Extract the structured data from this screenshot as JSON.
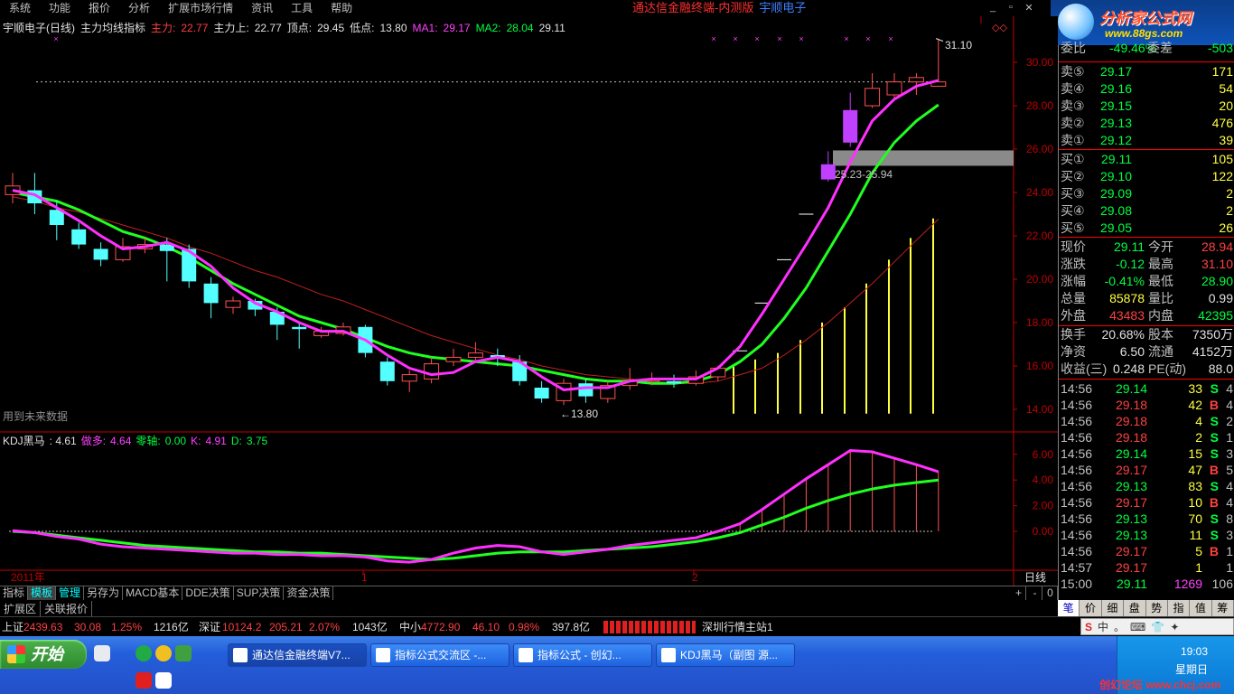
{
  "menu": [
    "系统",
    "功能",
    "报价",
    "分析",
    "扩展市场行情",
    "资讯",
    "工具",
    "帮助"
  ],
  "window_title": "通达信金融终端-内测版",
  "brand": "宇顺电子",
  "logo": {
    "main": "分析家公式网",
    "sub": "www.88gs.com"
  },
  "chart_header": {
    "name": "宇顺电子(日线)",
    "indicator": "主力均线指标",
    "zl_label": "主力:",
    "zl_value": "22.77",
    "zls_label": "主力上:",
    "zls_value": "22.77",
    "top_label": "顶点:",
    "top_value": "29.45",
    "low_label": "低点:",
    "low_value": "13.80",
    "ma1_label": "MA1:",
    "ma1_value": "29.17",
    "ma2_label": "MA2:",
    "ma2_value": "28.04",
    "last_value": "29.11"
  },
  "ind_header": {
    "name": "KDJ黑马",
    "value": ": 4.61",
    "zd_label": "做多:",
    "zd_value": "4.64",
    "zero_label": "零轴:",
    "zero_value": "0.00",
    "k_label": "K:",
    "k_value": "4.91",
    "d_label": "D:",
    "d_value": "3.75"
  },
  "chart_labels": {
    "high": "31.10",
    "low": "←13.80",
    "band": "25.23-25.94",
    "future": "用到未来数据",
    "year": "2011年",
    "m1": "1",
    "m2": "2",
    "period": "日线"
  },
  "price_axis": [
    "30.00",
    "28.00",
    "26.00",
    "24.00",
    "22.00",
    "20.00",
    "18.00",
    "16.00",
    "14.00"
  ],
  "ind_axis": [
    "6.00",
    "4.00",
    "2.00",
    "0.00"
  ],
  "panel": {
    "top_partial": {
      "label": "委比",
      "value": "-49.46%",
      "label2": "委差",
      "value2": "-503"
    },
    "sell": [
      {
        "label": "卖⑤",
        "price": "29.17",
        "vol": "171"
      },
      {
        "label": "卖④",
        "price": "29.16",
        "vol": "54"
      },
      {
        "label": "卖③",
        "price": "29.15",
        "vol": "20"
      },
      {
        "label": "卖②",
        "price": "29.13",
        "vol": "476"
      },
      {
        "label": "卖①",
        "price": "29.12",
        "vol": "39"
      }
    ],
    "buy": [
      {
        "label": "买①",
        "price": "29.11",
        "vol": "105"
      },
      {
        "label": "买②",
        "price": "29.10",
        "vol": "122"
      },
      {
        "label": "买③",
        "price": "29.09",
        "vol": "2"
      },
      {
        "label": "买④",
        "price": "29.08",
        "vol": "2"
      },
      {
        "label": "买⑤",
        "price": "29.05",
        "vol": "26"
      }
    ],
    "stats": [
      {
        "a": "现价",
        "b": "29.11",
        "c": "今开",
        "d": "28.94"
      },
      {
        "a": "涨跌",
        "b": "-0.12",
        "c": "最高",
        "d": "31.10"
      },
      {
        "a": "涨幅",
        "b": "-0.41%",
        "c": "最低",
        "d": "28.90"
      },
      {
        "a": "总量",
        "b": "85878",
        "c": "量比",
        "d": "0.99"
      },
      {
        "a": "外盘",
        "b": "43483",
        "c": "内盘",
        "d": "42395"
      }
    ],
    "stats2": [
      {
        "a": "换手",
        "b": "20.68%",
        "c": "股本",
        "d": "7350万"
      },
      {
        "a": "净资",
        "b": "6.50",
        "c": "流通",
        "d": "4152万"
      },
      {
        "a": "收益(三)",
        "b": "0.248",
        "c": "PE(动)",
        "d": "88.0"
      }
    ],
    "ticks": [
      {
        "t": "14:56",
        "p": "29.14",
        "v": "33",
        "s": "S",
        "n": "4"
      },
      {
        "t": "14:56",
        "p": "29.18",
        "v": "42",
        "s": "B",
        "n": "4"
      },
      {
        "t": "14:56",
        "p": "29.18",
        "v": "4",
        "s": "S",
        "n": "2"
      },
      {
        "t": "14:56",
        "p": "29.18",
        "v": "2",
        "s": "S",
        "n": "1"
      },
      {
        "t": "14:56",
        "p": "29.14",
        "v": "15",
        "s": "S",
        "n": "3"
      },
      {
        "t": "14:56",
        "p": "29.17",
        "v": "47",
        "s": "B",
        "n": "5"
      },
      {
        "t": "14:56",
        "p": "29.13",
        "v": "83",
        "s": "S",
        "n": "4"
      },
      {
        "t": "14:56",
        "p": "29.17",
        "v": "10",
        "s": "B",
        "n": "4"
      },
      {
        "t": "14:56",
        "p": "29.13",
        "v": "70",
        "s": "S",
        "n": "8"
      },
      {
        "t": "14:56",
        "p": "29.13",
        "v": "11",
        "s": "S",
        "n": "3"
      },
      {
        "t": "14:56",
        "p": "29.17",
        "v": "5",
        "s": "B",
        "n": "1"
      },
      {
        "t": "14:57",
        "p": "29.17",
        "v": "1",
        "s": "",
        "n": "1"
      },
      {
        "t": "15:00",
        "p": "29.11",
        "v": "1269",
        "s": "",
        "n": "106"
      }
    ],
    "tabs": [
      "笔",
      "价",
      "细",
      "盘",
      "势",
      "指",
      "值",
      "筹"
    ]
  },
  "chart_tabs": [
    "指标",
    "模板",
    "管理",
    "另存为",
    "MACD基本",
    "DDE决策",
    "SUP决策",
    "资金决策"
  ],
  "chart_ctrls": [
    "+",
    "-",
    "0"
  ],
  "tabs2": [
    "扩展区",
    "关联报价"
  ],
  "status": {
    "sh_label": "上证",
    "sh_val": "2439.63",
    "sh_chg": "30.08",
    "sh_pct": "1.25%",
    "sh_amt": "1216亿",
    "sz_label": "深证",
    "sz_val": "10124.2",
    "sz_chg": "205.21",
    "sz_pct": "2.07%",
    "sz_amt": "1043亿",
    "zx_label": "中小",
    "zx_val": "4772.90",
    "zx_chg": "46.10",
    "zx_pct": "0.98%",
    "zx_amt": "397.8亿",
    "station": "深圳行情主站1"
  },
  "ime": [
    "中",
    "。"
  ],
  "taskbar": {
    "start": "开始",
    "tasks": [
      "通达信金融终端V7...",
      "指标公式交流区 -...",
      "指标公式 - 创幻...",
      "KDJ黑马（副图 源..."
    ],
    "time": "19:03",
    "day": "星期日",
    "watermark": "创幻论坛 www.chcj.com"
  },
  "chart_data": {
    "type": "candlestick",
    "price_range": [
      13.0,
      31.5
    ],
    "candles": [
      {
        "o": 23.9,
        "c": 24.3,
        "h": 24.9,
        "l": 23.5
      },
      {
        "o": 24.1,
        "c": 23.5,
        "h": 24.9,
        "l": 23.0
      },
      {
        "o": 23.2,
        "c": 22.5,
        "h": 23.6,
        "l": 21.8
      },
      {
        "o": 22.3,
        "c": 21.6,
        "h": 22.6,
        "l": 21.4
      },
      {
        "o": 21.4,
        "c": 20.9,
        "h": 21.7,
        "l": 20.6
      },
      {
        "o": 20.9,
        "c": 21.5,
        "h": 21.9,
        "l": 20.8
      },
      {
        "o": 21.4,
        "c": 21.6,
        "h": 21.9,
        "l": 21.2
      },
      {
        "o": 21.6,
        "c": 21.3,
        "h": 21.9,
        "l": 19.9
      },
      {
        "o": 21.4,
        "c": 19.9,
        "h": 21.6,
        "l": 19.6
      },
      {
        "o": 19.8,
        "c": 18.9,
        "h": 20.1,
        "l": 18.2
      },
      {
        "o": 18.7,
        "c": 19.0,
        "h": 19.2,
        "l": 18.4
      },
      {
        "o": 19.0,
        "c": 18.6,
        "h": 19.1,
        "l": 18.3
      },
      {
        "o": 18.5,
        "c": 17.9,
        "h": 18.7,
        "l": 17.2
      },
      {
        "o": 17.8,
        "c": 17.7,
        "h": 18.0,
        "l": 16.8
      },
      {
        "o": 17.4,
        "c": 17.6,
        "h": 17.8,
        "l": 17.3
      },
      {
        "o": 17.5,
        "c": 17.8,
        "h": 18.0,
        "l": 17.4
      },
      {
        "o": 17.8,
        "c": 16.6,
        "h": 17.9,
        "l": 16.4
      },
      {
        "o": 16.2,
        "c": 15.3,
        "h": 16.4,
        "l": 15.1
      },
      {
        "o": 15.3,
        "c": 15.6,
        "h": 15.8,
        "l": 14.8
      },
      {
        "o": 15.4,
        "c": 16.1,
        "h": 16.4,
        "l": 15.2
      },
      {
        "o": 16.2,
        "c": 16.4,
        "h": 16.8,
        "l": 16.0
      },
      {
        "o": 16.4,
        "c": 16.6,
        "h": 17.1,
        "l": 16.2
      },
      {
        "o": 16.5,
        "c": 16.4,
        "h": 16.8,
        "l": 16.0
      },
      {
        "o": 16.2,
        "c": 15.3,
        "h": 16.5,
        "l": 15.1
      },
      {
        "o": 15.0,
        "c": 14.5,
        "h": 15.3,
        "l": 14.3
      },
      {
        "o": 14.4,
        "c": 15.2,
        "h": 15.4,
        "l": 14.2
      },
      {
        "o": 15.2,
        "c": 14.6,
        "h": 15.4,
        "l": 14.3
      },
      {
        "o": 14.5,
        "c": 15.1,
        "h": 15.3,
        "l": 14.3
      },
      {
        "o": 15.1,
        "c": 15.3,
        "h": 15.9,
        "l": 14.9
      },
      {
        "o": 15.3,
        "c": 15.4,
        "h": 15.7,
        "l": 15.1
      },
      {
        "o": 15.3,
        "c": 15.2,
        "h": 15.6,
        "l": 15.0
      },
      {
        "o": 15.2,
        "c": 15.5,
        "h": 15.8,
        "l": 15.1
      },
      {
        "o": 15.5,
        "c": 15.9,
        "h": 16.0,
        "l": 15.3
      },
      {
        "o": 16.7,
        "c": 16.7,
        "h": 16.7,
        "l": 16.7
      },
      {
        "o": 18.9,
        "c": 18.9,
        "h": 18.9,
        "l": 18.9
      },
      {
        "o": 20.9,
        "c": 20.9,
        "h": 20.9,
        "l": 20.9
      },
      {
        "o": 23.0,
        "c": 23.0,
        "h": 23.0,
        "l": 23.0
      },
      {
        "o": 24.6,
        "c": 25.3,
        "h": 25.9,
        "l": 24.5
      },
      {
        "o": 26.3,
        "c": 27.8,
        "h": 28.6,
        "l": 26.1
      },
      {
        "o": 28.0,
        "c": 28.8,
        "h": 29.5,
        "l": 27.9
      },
      {
        "o": 28.5,
        "c": 29.1,
        "h": 29.5,
        "l": 28.3
      },
      {
        "o": 29.1,
        "c": 29.3,
        "h": 29.5,
        "l": 28.5
      },
      {
        "o": 28.9,
        "c": 29.1,
        "h": 31.1,
        "l": 28.9
      }
    ],
    "ma1": [
      24.1,
      23.9,
      23.3,
      22.7,
      22.0,
      21.4,
      21.5,
      21.7,
      21.3,
      20.6,
      19.6,
      18.9,
      18.5,
      18.0,
      17.6,
      17.6,
      17.2,
      16.5,
      15.9,
      15.6,
      15.7,
      16.2,
      16.4,
      16.2,
      15.5,
      14.9,
      15.0,
      15.0,
      15.3,
      15.4,
      15.4,
      15.4,
      15.9,
      16.9,
      18.4,
      20.0,
      21.6,
      23.3,
      25.4,
      27.3,
      28.3,
      28.9,
      29.17
    ],
    "ma2": [
      24.0,
      23.8,
      23.6,
      23.2,
      22.7,
      22.2,
      21.9,
      21.5,
      21.0,
      20.4,
      19.8,
      19.3,
      18.8,
      18.3,
      18.0,
      17.7,
      17.3,
      16.9,
      16.6,
      16.4,
      16.3,
      16.2,
      16.1,
      16.0,
      15.8,
      15.6,
      15.4,
      15.3,
      15.3,
      15.2,
      15.2,
      15.3,
      15.6,
      16.2,
      17.0,
      18.2,
      19.6,
      21.3,
      23.0,
      24.9,
      26.3,
      27.3,
      28.04
    ],
    "zl": [
      23.8,
      23.6,
      23.3,
      23.1,
      22.8,
      22.5,
      22.2,
      21.9,
      21.5,
      21.2,
      20.8,
      20.4,
      20.1,
      19.7,
      19.3,
      19.0,
      18.6,
      18.2,
      17.8,
      17.4,
      17.1,
      16.8,
      16.5,
      16.3,
      16.0,
      15.8,
      15.6,
      15.5,
      15.4,
      15.3,
      15.2,
      15.2,
      15.3,
      15.6,
      15.9,
      16.5,
      17.2,
      18.0,
      18.9,
      19.8,
      20.8,
      21.8,
      22.77
    ],
    "kdj_main": [
      0.05,
      -0.1,
      -0.4,
      -0.6,
      -1.0,
      -1.2,
      -1.3,
      -1.4,
      -1.5,
      -1.6,
      -1.7,
      -1.7,
      -1.8,
      -1.8,
      -1.9,
      -1.9,
      -2.0,
      -2.3,
      -2.4,
      -2.2,
      -1.7,
      -1.3,
      -1.1,
      -1.2,
      -1.6,
      -1.8,
      -1.6,
      -1.4,
      -1.1,
      -0.9,
      -0.7,
      -0.5,
      0.0,
      0.6,
      1.7,
      2.9,
      4.1,
      5.2,
      6.3,
      6.2,
      5.7,
      5.2,
      4.64
    ],
    "kdj_sig": [
      0.0,
      -0.1,
      -0.3,
      -0.5,
      -0.7,
      -0.9,
      -1.1,
      -1.2,
      -1.3,
      -1.4,
      -1.5,
      -1.6,
      -1.6,
      -1.7,
      -1.7,
      -1.8,
      -1.9,
      -2.0,
      -2.1,
      -2.2,
      -2.1,
      -1.9,
      -1.7,
      -1.6,
      -1.6,
      -1.6,
      -1.5,
      -1.4,
      -1.3,
      -1.2,
      -1.0,
      -0.8,
      -0.5,
      -0.1,
      0.5,
      1.1,
      1.8,
      2.4,
      2.9,
      3.3,
      3.6,
      3.8,
      4.0
    ]
  }
}
